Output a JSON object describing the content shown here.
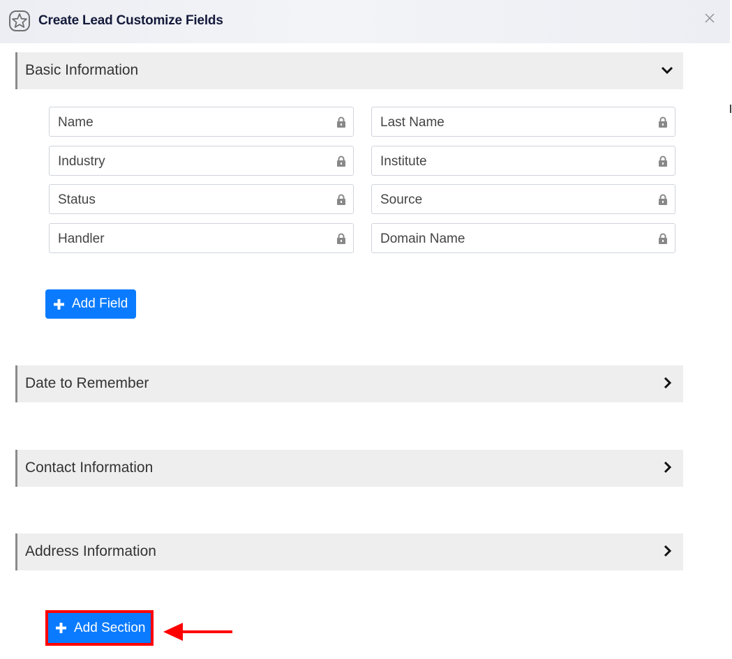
{
  "modal": {
    "title": "Create Lead Customize Fields",
    "icon": "star-icon",
    "close_icon": "close-icon"
  },
  "sections": [
    {
      "label": "Basic Information",
      "state": "expanded",
      "chevron": "chevron-down-icon",
      "fields": [
        {
          "label": "Name",
          "locked": true
        },
        {
          "label": "Last Name",
          "locked": true
        },
        {
          "label": "Industry",
          "locked": true
        },
        {
          "label": "Institute",
          "locked": true
        },
        {
          "label": "Status",
          "locked": true
        },
        {
          "label": "Source",
          "locked": true
        },
        {
          "label": "Handler",
          "locked": true
        },
        {
          "label": "Domain Name",
          "locked": true
        }
      ],
      "add_field_label": "Add Field"
    },
    {
      "label": "Date to Remember",
      "state": "collapsed",
      "chevron": "chevron-right-icon"
    },
    {
      "label": "Contact Information",
      "state": "collapsed",
      "chevron": "chevron-right-icon"
    },
    {
      "label": "Address Information",
      "state": "collapsed",
      "chevron": "chevron-right-icon"
    }
  ],
  "add_section_label": "Add Section",
  "annotation": {
    "highlight_color": "#ff0000",
    "arrow_target": "add-section-button"
  },
  "colors": {
    "primary": "#0a7bff",
    "header_text": "#141a3a",
    "section_bg": "#eeeeee",
    "highlight": "#ff0000"
  }
}
